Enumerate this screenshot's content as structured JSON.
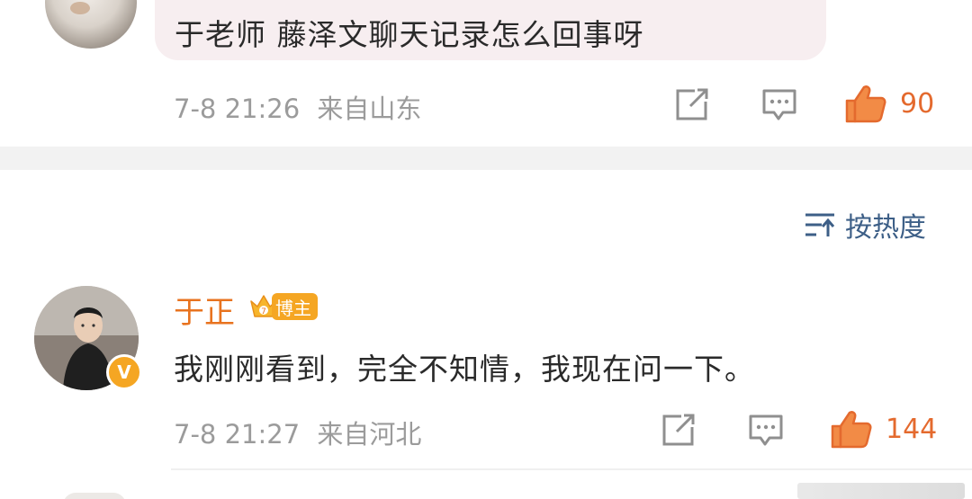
{
  "comments": [
    {
      "text": "于老师 藤泽文聊天记录怎么回事呀",
      "date": "7-8 21:26",
      "location": "来自山东",
      "likes": "90",
      "icons": [
        "share-icon",
        "comment-icon",
        "like-icon"
      ]
    },
    {
      "username": "于正",
      "badge": "博主",
      "text": "我刚刚看到，完全不知情，我现在问一下。",
      "date": "7-8 21:27",
      "location": "来自河北",
      "likes": "144",
      "verified_mark": "V",
      "icons": [
        "share-icon",
        "comment-icon",
        "like-icon"
      ]
    }
  ],
  "sort": {
    "label": "按热度",
    "icon": "sort-icon"
  },
  "colors": {
    "like": "#e46a2e",
    "username": "#e8731f",
    "badge": "#f5a623",
    "sort": "#3d5f87",
    "meta": "#9b9b9b",
    "bubble": "#f7eef0"
  }
}
